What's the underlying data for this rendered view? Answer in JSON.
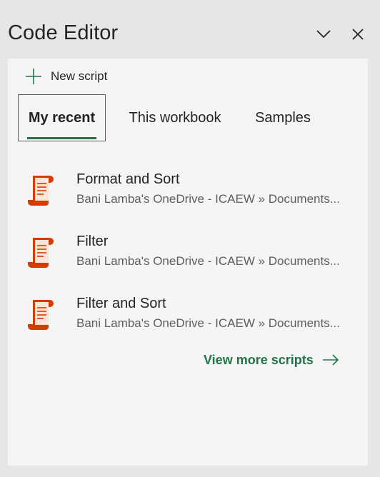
{
  "header": {
    "title": "Code Editor",
    "collapse_icon": "chevron-down-icon",
    "close_icon": "close-icon"
  },
  "toolbar": {
    "new_script_label": "New script",
    "new_script_icon": "plus-icon"
  },
  "tabs": [
    {
      "label": "My recent",
      "active": true
    },
    {
      "label": "This workbook",
      "active": false
    },
    {
      "label": "Samples",
      "active": false
    }
  ],
  "scripts": [
    {
      "name": "Format and Sort",
      "path": "Bani Lamba's OneDrive - ICAEW » Documents...",
      "icon": "script-icon"
    },
    {
      "name": "Filter",
      "path": "Bani Lamba's OneDrive - ICAEW » Documents...",
      "icon": "script-icon"
    },
    {
      "name": "Filter and Sort",
      "path": "Bani Lamba's OneDrive - ICAEW » Documents...",
      "icon": "script-icon"
    }
  ],
  "footer": {
    "view_more_label": "View more scripts",
    "view_more_icon": "arrow-right-icon"
  },
  "colors": {
    "accent": "#217346",
    "script_icon": "#d83b01",
    "panel_bg": "#f5f5f5",
    "page_bg": "#e6e6e6"
  }
}
